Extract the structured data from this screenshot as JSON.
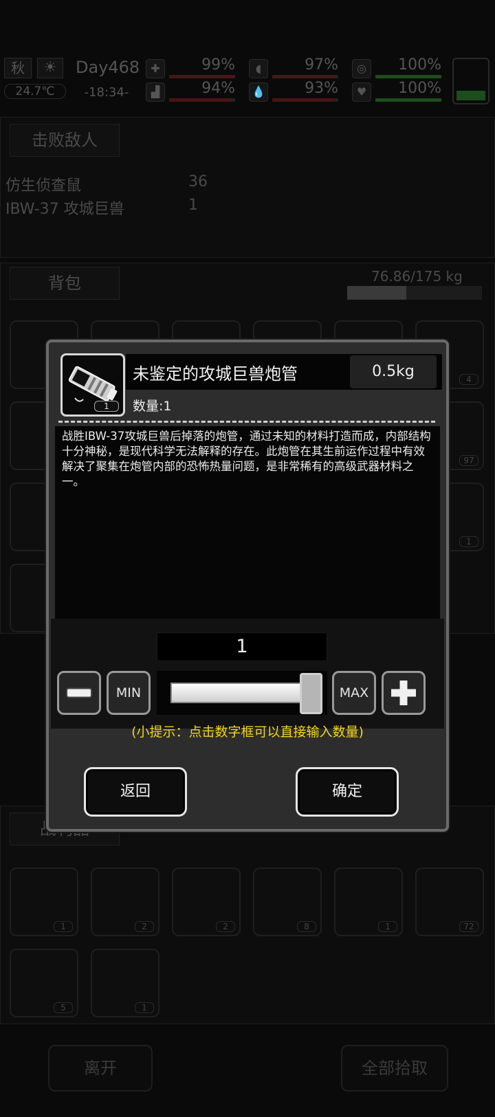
{
  "status": {
    "season": "秋",
    "temperature": "24.7℃",
    "day": "Day468",
    "time": "-18:34-",
    "stats": [
      {
        "icon": "medkit-icon",
        "value": "99%",
        "level": 0.99
      },
      {
        "icon": "stomach-icon",
        "value": "97%",
        "level": 0.97
      },
      {
        "icon": "pill-icon",
        "value": "100%",
        "level": 1.0
      },
      {
        "icon": "leg-icon",
        "value": "94%",
        "level": 0.94
      },
      {
        "icon": "water-drop-icon",
        "value": "93%",
        "level": 0.93
      },
      {
        "icon": "heart-icon",
        "value": "100%",
        "level": 1.0
      }
    ]
  },
  "background": {
    "defeated_tab": "击败敌人",
    "enemies": [
      {
        "name": "仿生侦查鼠",
        "count": "36"
      },
      {
        "name": "IBW-37 攻城巨兽",
        "count": "1"
      }
    ],
    "backpack_tab": "背包",
    "backpack_weight": "76.86/175 kg",
    "backpack_fill": 0.44,
    "backpack_slot_counts": [
      "4",
      "97",
      "1"
    ],
    "loot_tab": "战利品",
    "loot_slots": [
      {
        "icon": "boot-part-icon",
        "count": "1"
      },
      {
        "icon": "screw-icon",
        "count": "2"
      },
      {
        "icon": "ore-chunks-icon",
        "count": "2"
      },
      {
        "icon": "metal-bar-icon",
        "count": "8"
      },
      {
        "icon": "cannon-barrel-icon",
        "count": "1"
      },
      {
        "icon": "wire-icon",
        "count": "72"
      },
      {
        "icon": "battery-icon",
        "count": "5"
      },
      {
        "icon": "cloth-icon",
        "count": "1"
      }
    ],
    "leave_button": "离开",
    "take_all_button": "全部拾取"
  },
  "modal": {
    "item_title": "未鉴定的攻城巨兽炮管",
    "weight": "0.5kg",
    "icon_count": "1",
    "quantity_label": "数量:1",
    "description": "战胜IBW-37攻城巨兽后掉落的炮管，通过未知的材料打造而成，内部结构十分神秘，是现代科学无法解释的存在。此炮管在其生前运作过程中有效解决了聚集在炮管内部的恐怖热量问题，是非常稀有的高级武器材料之一。",
    "quantity_value": "1",
    "min_label": "MIN",
    "max_label": "MAX",
    "slider_level": 1.0,
    "hint": "(小提示：点击数字框可以直接输入数量)",
    "back_button": "返回",
    "confirm_button": "确定"
  }
}
